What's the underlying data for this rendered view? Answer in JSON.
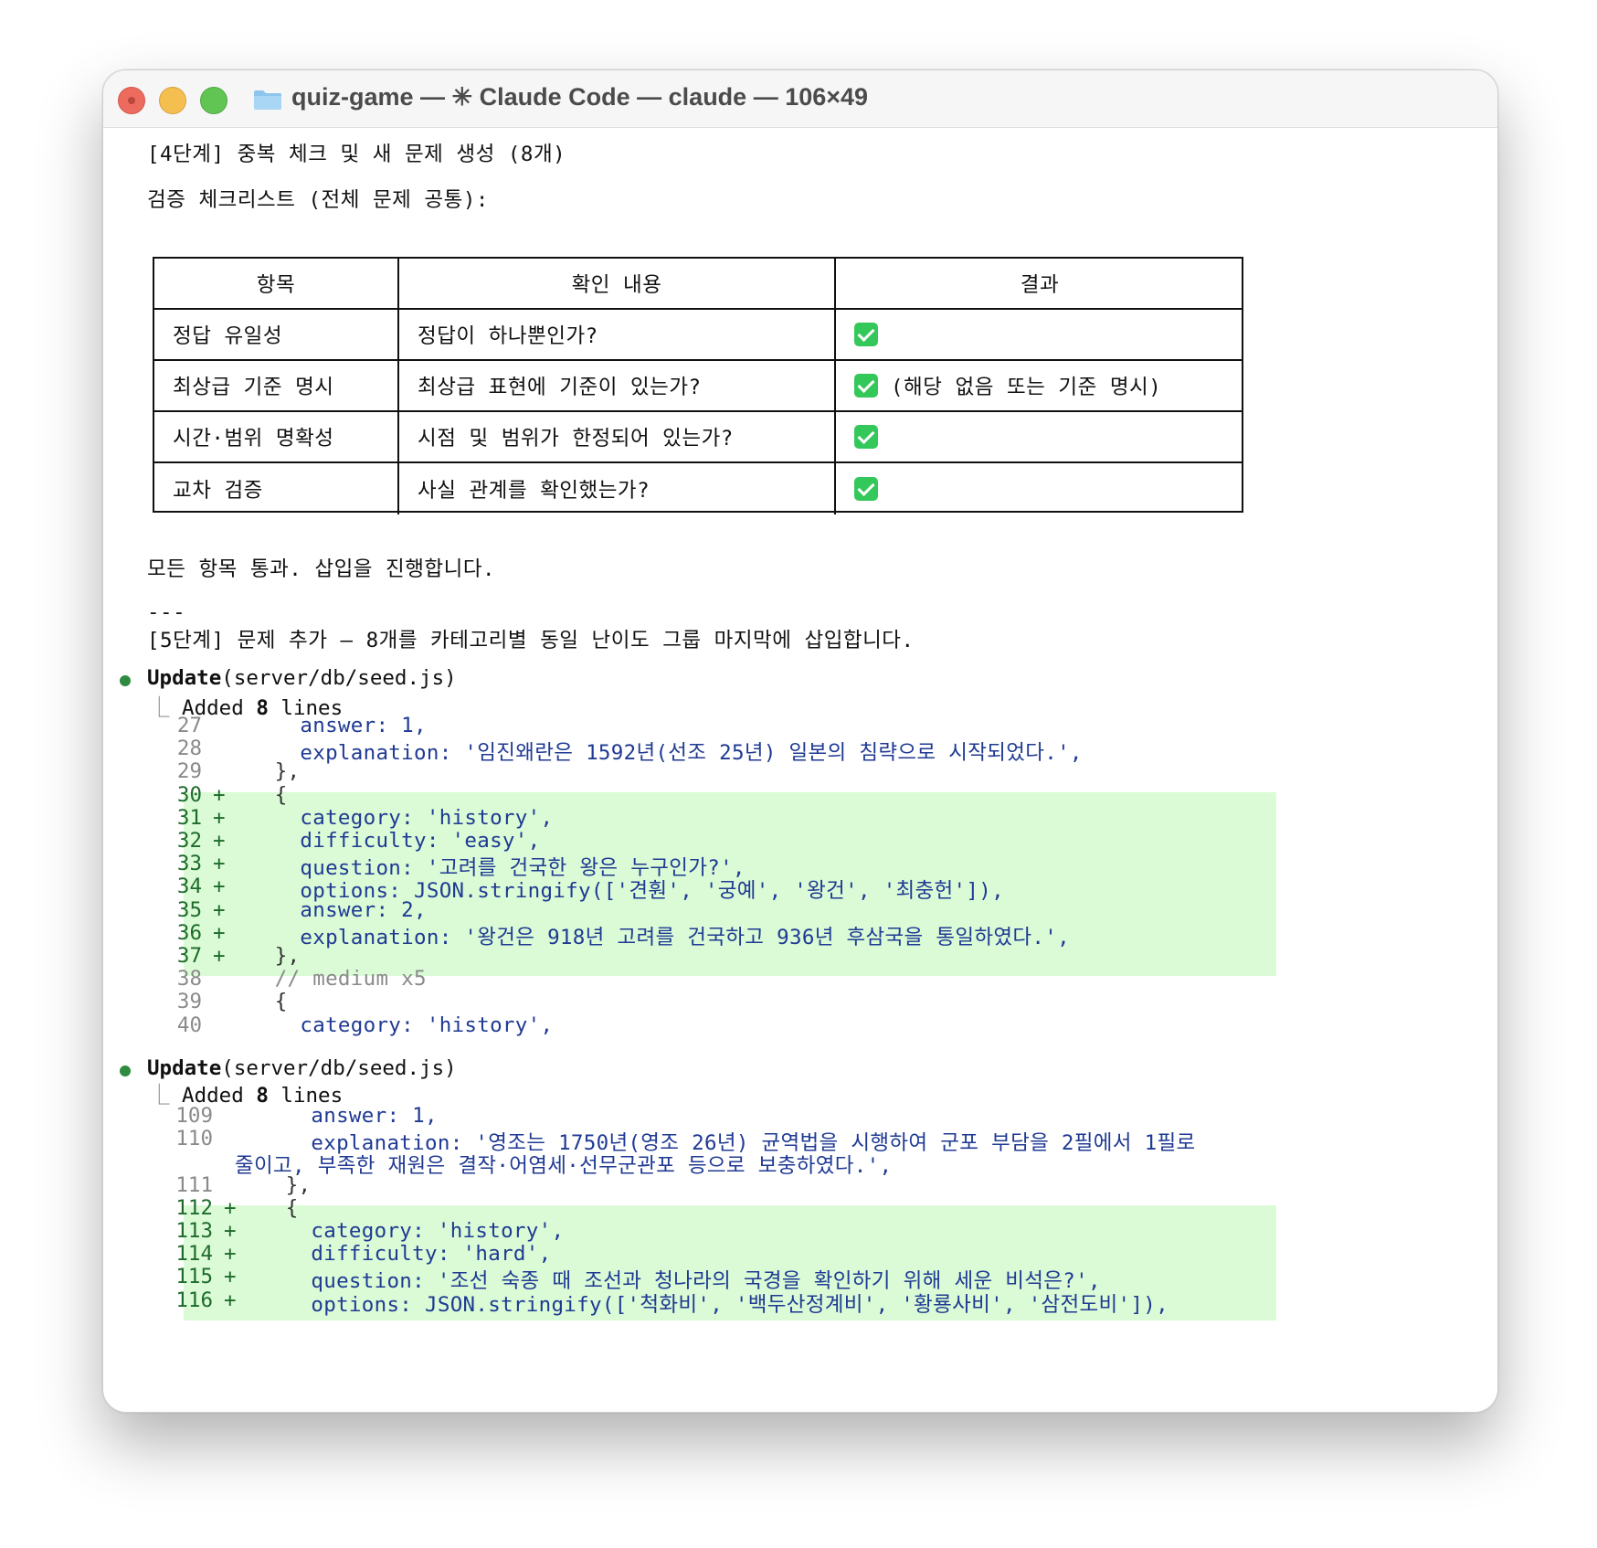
{
  "window": {
    "title": "quiz-game — ✳ Claude Code — claude — 106×49"
  },
  "text": {
    "step4_heading": "[4단계] 중복 체크 및 새 문제 생성 (8개)",
    "checklist_title": "검증 체크리스트 (전체 문제 공통):",
    "all_pass": "모든 항목 통과. 삽입을 진행합니다.",
    "separator": "---",
    "step5_heading": "[5단계] 문제 추가 — 8개를 카테고리별 동일 난이도 그룹 마지막에 삽입합니다."
  },
  "table": {
    "headers": [
      "항목",
      "확인 내용",
      "결과"
    ],
    "rows": [
      {
        "item": "정답 유일성",
        "check": "정답이 하나뿐인가?",
        "note": ""
      },
      {
        "item": "최상급 기준 명시",
        "check": "최상급 표현에 기준이 있는가?",
        "note": "(해당 없음 또는 기준 명시)"
      },
      {
        "item": "시간·범위 명확성",
        "check": "시점 및 범위가 한정되어 있는가?",
        "note": ""
      },
      {
        "item": "교차 검증",
        "check": "사실 관계를 확인했는가?",
        "note": ""
      }
    ]
  },
  "updates": [
    {
      "tool": "Update",
      "args": "(server/db/seed.js)",
      "result_prefix": "Added ",
      "result_count": "8",
      "result_suffix": " lines"
    },
    {
      "tool": "Update",
      "args": "(server/db/seed.js)",
      "result_prefix": "Added ",
      "result_count": "8",
      "result_suffix": " lines"
    }
  ],
  "diff1": [
    {
      "n": "27",
      "add": false,
      "code": "    answer: 1,"
    },
    {
      "n": "28",
      "add": false,
      "code": "    explanation: '임진왜란은 1592년(선조 25년) 일본의 침략으로 시작되었다.',"
    },
    {
      "n": "29",
      "add": false,
      "code": "  },"
    },
    {
      "n": "30",
      "add": true,
      "code": "  {"
    },
    {
      "n": "31",
      "add": true,
      "code": "    category: 'history',"
    },
    {
      "n": "32",
      "add": true,
      "code": "    difficulty: 'easy',"
    },
    {
      "n": "33",
      "add": true,
      "code": "    question: '고려를 건국한 왕은 누구인가?',"
    },
    {
      "n": "34",
      "add": true,
      "code": "    options: JSON.stringify(['견훤', '궁예', '왕건', '최충헌']),"
    },
    {
      "n": "35",
      "add": true,
      "code": "    answer: 2,"
    },
    {
      "n": "36",
      "add": true,
      "code": "    explanation: '왕건은 918년 고려를 건국하고 936년 후삼국을 통일하였다.',"
    },
    {
      "n": "37",
      "add": true,
      "code": "  },"
    },
    {
      "n": "38",
      "add": false,
      "code": "  // medium x5"
    },
    {
      "n": "39",
      "add": false,
      "code": "  {"
    },
    {
      "n": "40",
      "add": false,
      "code": "    category: 'history',"
    }
  ],
  "diff2": [
    {
      "n": "109",
      "add": false,
      "code": "    answer: 1,"
    },
    {
      "n": "110",
      "add": false,
      "code": "    explanation: '영조는 1750년(영조 26년) 균역법을 시행하여 군포 부담을 2필에서 1필로"
    },
    {
      "n": "",
      "add": false,
      "code": "줄이고, 부족한 재원은 결작·어염세·선무군관포 등으로 보충하였다.',"
    },
    {
      "n": "111",
      "add": false,
      "code": "  },"
    },
    {
      "n": "112",
      "add": true,
      "code": "  {"
    },
    {
      "n": "113",
      "add": true,
      "code": "    category: 'history',"
    },
    {
      "n": "114",
      "add": true,
      "code": "    difficulty: 'hard',"
    },
    {
      "n": "115",
      "add": true,
      "code": "    question: '조선 숙종 때 조선과 청나라의 국경을 확인하기 위해 세운 비석은?',"
    },
    {
      "n": "116",
      "add": true,
      "code": "    options: JSON.stringify(['척화비', '백두산정계비', '황룡사비', '삼전도비']),"
    }
  ],
  "colors": {
    "diff_add_bg": "#dafbd6",
    "diff_add_fg": "#1e6b2b",
    "bullet": "#2e8b3f",
    "code_text": "#1f3a93"
  },
  "icons": {
    "folder": "folder-icon",
    "check": "check-mark-icon",
    "bullet": "status-dot-icon"
  }
}
